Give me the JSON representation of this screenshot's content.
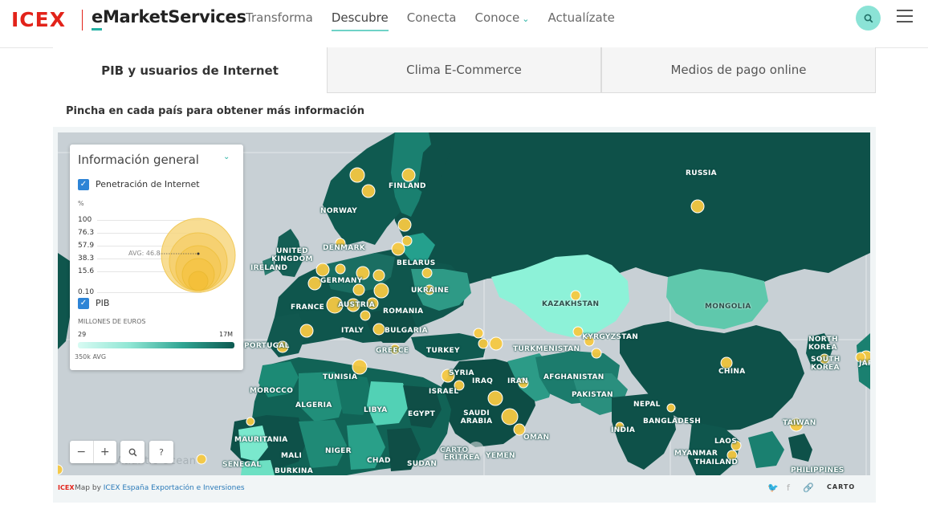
{
  "header": {
    "logo_icex": "ICEX",
    "logo_ems": "eMarketServices",
    "nav": [
      {
        "label": "Transforma",
        "active": false
      },
      {
        "label": "Descubre",
        "active": true
      },
      {
        "label": "Conecta",
        "active": false
      },
      {
        "label": "Conoce",
        "active": false,
        "dropdown": true
      },
      {
        "label": "Actualízate",
        "active": false
      }
    ],
    "search_icon": "search-icon",
    "menu_icon": "hamburger-icon"
  },
  "tabs": [
    {
      "label": "PIB y usuarios de Internet",
      "active": true
    },
    {
      "label": "Clima E-Commerce",
      "active": false
    },
    {
      "label": "Medios de pago online",
      "active": false
    }
  ],
  "instruction": "Pincha en cada país para obtener más información",
  "legend": {
    "title": "Información general",
    "internet": {
      "label": "Penetración de Internet",
      "checked": true,
      "unit": "%",
      "ticks": [
        "100",
        "76.3",
        "57.9",
        "38.3",
        "15.6",
        "0.10"
      ],
      "avg": "AVG: 46.8"
    },
    "pib": {
      "label": "PIB",
      "checked": true,
      "unit": "MILLONES DE EUROS",
      "min": "29",
      "max": "17M",
      "avg": "350k AVG"
    }
  },
  "map": {
    "countries": [
      "RUSSIA",
      "FINLAND",
      "NORWAY",
      "DENMARK",
      "UNITED KINGDOM",
      "IRELAND",
      "BELARUS",
      "GERMANY",
      "UKRAINE",
      "FRANCE",
      "AUSTRIA",
      "ROMANIA",
      "ITALY",
      "BULGARIA",
      "PORTUGAL",
      "GREECE",
      "TURKEY",
      "KAZAKHSTAN",
      "MONGOLIA",
      "KYRGYZSTAN",
      "TURKMENISTAN",
      "NORTH KOREA",
      "SOUTH KOREA",
      "JAPAN",
      "CHINA",
      "AFGHANISTAN",
      "SYRIA",
      "TUNISIA",
      "IRAN",
      "IRAQ",
      "MOROCCO",
      "ISRAEL",
      "PAKISTAN",
      "ALGERIA",
      "LIBYA",
      "EGYPT",
      "SAUDI ARABIA",
      "NEPAL",
      "BANGLADESH",
      "TAIWAN",
      "INDIA",
      "OMAN",
      "MAURITANIA",
      "CARTO",
      "LAOS",
      "MALI",
      "NIGER",
      "ERITREA",
      "YEMEN",
      "MYANMAR",
      "CHAD",
      "SUDAN",
      "THAILAND",
      "SENEGAL",
      "BURKINA",
      "PHILIPPINES",
      "Atlantic Ocean"
    ],
    "attribution_prefix": "Map by",
    "attribution_link": "ICEX España Exportación e Inversiones",
    "carto": "CARTO"
  },
  "controls": {
    "zoom_out": "−",
    "zoom_in": "+",
    "help": "?"
  },
  "colors": {
    "accent": "#2bb3a5",
    "brand_red": "#e2231a",
    "bubble": "#f5c842",
    "dark_teal": "#0e4b44"
  }
}
